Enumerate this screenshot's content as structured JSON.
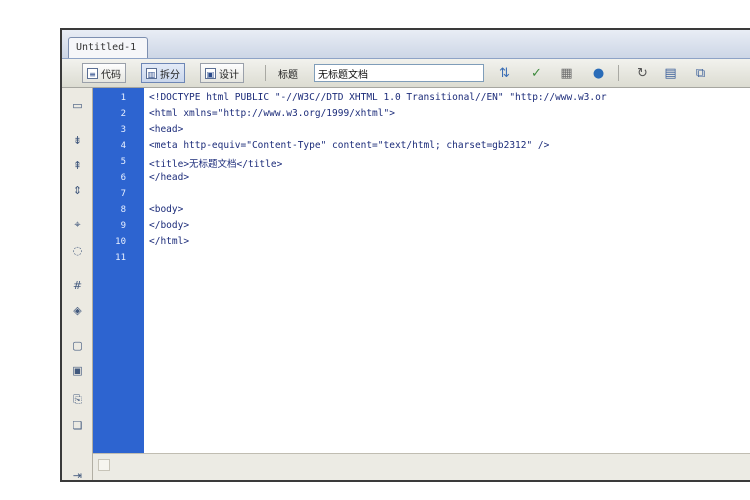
{
  "document": {
    "tab_title": "Untitled-1"
  },
  "toolbar": {
    "buttons": [
      {
        "label": "代码",
        "icon": "code-view-icon"
      },
      {
        "label": "拆分",
        "icon": "split-view-icon",
        "active": true
      },
      {
        "label": "设计",
        "icon": "design-view-icon"
      }
    ],
    "title_label": "标题",
    "title_value": "无标题文档",
    "tools": [
      "file-management-icon",
      "preview-in-browser-icon",
      "validate-icon",
      "check-browser-icon",
      "refresh-icon",
      "view-options-icon",
      "visual-aids-icon"
    ]
  },
  "sidebar": {
    "icons": [
      "open-documents-icon",
      "collapse-tag-icon",
      "collapse-selection-icon",
      "expand-all-icon",
      "select-parent-tag-icon",
      "balance-braces-icon",
      "line-numbers-icon",
      "highlight-invalid-code-icon",
      "apply-comment-icon",
      "remove-comment-icon",
      "wrap-tag-icon",
      "recent-snippets-icon",
      "indent-icon"
    ]
  },
  "editor": {
    "line_numbers": [
      "1",
      "2",
      "3",
      "4",
      "5",
      "6",
      "7",
      "8",
      "9",
      "10",
      "11"
    ],
    "lines": [
      "<!DOCTYPE html PUBLIC \"-//W3C//DTD XHTML 1.0 Transitional//EN\" \"http://www.w3.or",
      "<html xmlns=\"http://www.w3.org/1999/xhtml\">",
      "<head>",
      "<meta http-equiv=\"Content-Type\" content=\"text/html; charset=gb2312\" />",
      "<title>无标题文档</title>",
      "</head>",
      "",
      "<body>",
      "</body>",
      "</html>",
      ""
    ]
  },
  "colors": {
    "gutter": "#2d64d0",
    "code_text": "#1c2c7a",
    "chrome": "#d4d0c8"
  }
}
